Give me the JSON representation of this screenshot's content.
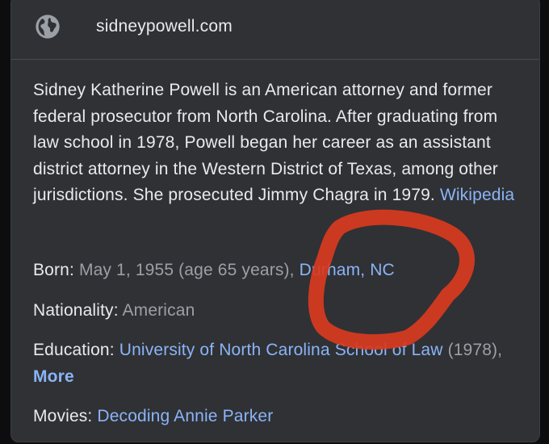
{
  "header": {
    "site": "sidneypowell.com",
    "icon": "globe-icon"
  },
  "description": {
    "text": "Sidney Katherine Powell is an American attorney and former federal prosecutor from North Carolina. After graduating from law school in 1978, Powell began her career as an assistant district attorney in the Western District of Texas, among other jurisdictions. She prosecuted Jimmy Chagra in 1979. ",
    "source_link": "Wikipedia"
  },
  "facts": {
    "born": {
      "label": "Born",
      "date": "May 1, 1955 (age 65 years)",
      "place": "Durham, NC"
    },
    "nationality": {
      "label": "Nationality",
      "value": "American"
    },
    "education": {
      "label": "Education",
      "school": "University of North Carolina School of Law",
      "year": "(1978)",
      "more": "More"
    },
    "movies": {
      "label": "Movies",
      "value": "Decoding Annie Parker"
    }
  },
  "colors": {
    "card_bg": "#303134",
    "text": "#e8eaed",
    "muted": "#9aa0a6",
    "link": "#8ab4f8",
    "annotation": "#d93a1f"
  }
}
